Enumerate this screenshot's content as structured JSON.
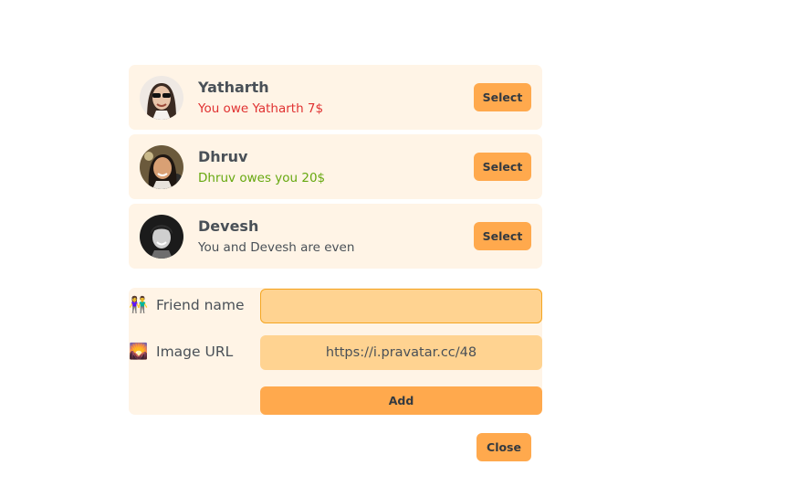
{
  "friends": [
    {
      "name": "Yatharth",
      "status": "You owe Yatharth 7$",
      "status_type": "red",
      "select_label": "Select"
    },
    {
      "name": "Dhruv",
      "status": "Dhruv owes you 20$",
      "status_type": "green",
      "select_label": "Select"
    },
    {
      "name": "Devesh",
      "status": "You and Devesh are even",
      "status_type": "neutral",
      "select_label": "Select"
    }
  ],
  "form": {
    "friend_name_emoji": "👫",
    "friend_name_label": "Friend name",
    "friend_name_value": "",
    "image_url_emoji": "🌄",
    "image_url_label": "Image URL",
    "image_url_value": "https://i.pravatar.cc/48",
    "add_label": "Add"
  },
  "close_label": "Close",
  "colors": {
    "accent": "#ffa94d",
    "panel_bg": "#fff4e6",
    "input_bg": "#ffd391",
    "owe_red": "#e03131",
    "owed_green": "#66a80f"
  }
}
